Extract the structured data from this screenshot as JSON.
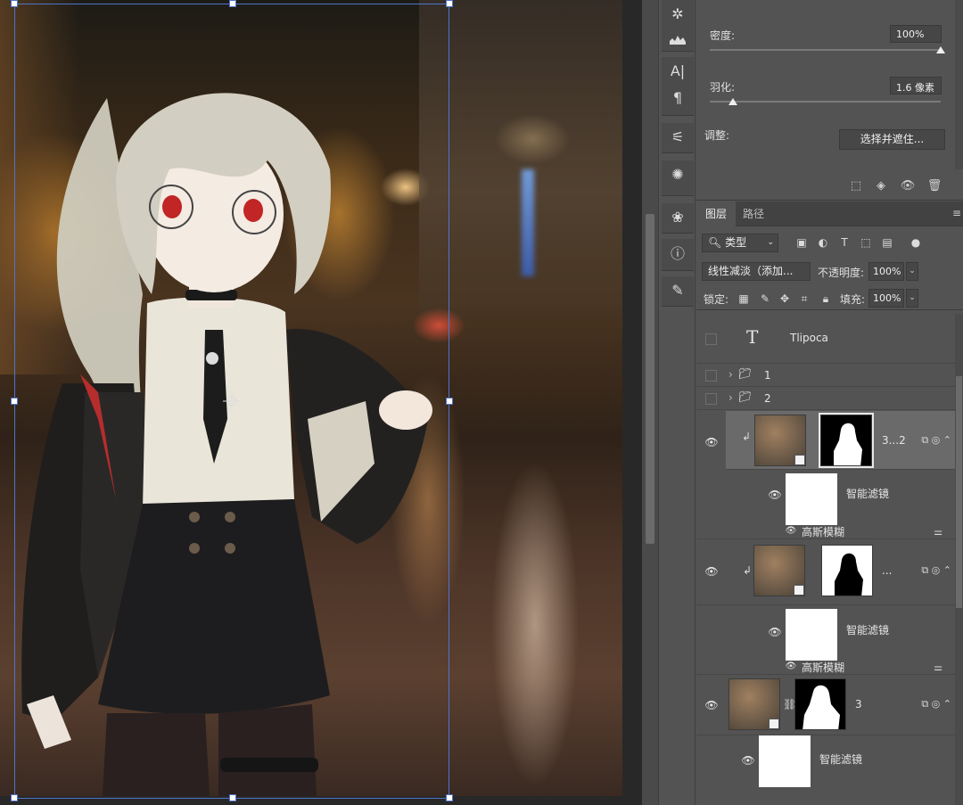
{
  "properties": {
    "density_label": "密度:",
    "density_value": "100%",
    "density_fraction": 1.0,
    "feather_label": "羽化:",
    "feather_value": "1.6 像素",
    "feather_fraction": 0.1,
    "adjust_label": "调整:",
    "select_and_mask_label": "选择并遮住..."
  },
  "layers_panel": {
    "tabs": [
      {
        "label": "图层",
        "active": true
      },
      {
        "label": "路径",
        "active": false
      }
    ],
    "filter_kind": "类型",
    "blend_mode": "线性减淡（添加...",
    "opacity_label": "不透明度:",
    "opacity_value": "100%",
    "lock_label": "锁定:",
    "fill_label": "填充:",
    "fill_value": "100%",
    "layers": [
      {
        "type": "text",
        "name": "Tlipoca"
      },
      {
        "type": "group",
        "name": "1"
      },
      {
        "type": "group",
        "name": "2"
      },
      {
        "type": "smart",
        "name": "3...2",
        "filter_label": "智能滤镜",
        "filter_name": "高斯模糊"
      },
      {
        "type": "smart",
        "name": "...",
        "filter_label": "智能滤镜",
        "filter_name": "高斯模糊"
      },
      {
        "type": "smart",
        "name": "3",
        "filter_label": "智能滤镜"
      }
    ]
  },
  "icons": {
    "tool_icons": [
      "ray-icon",
      "histogram-icon",
      "character-icon",
      "paragraph-icon",
      "adjust-sliders-icon",
      "brush-preset-icon",
      "channels-icon",
      "info-icon",
      "brush-icon"
    ]
  }
}
